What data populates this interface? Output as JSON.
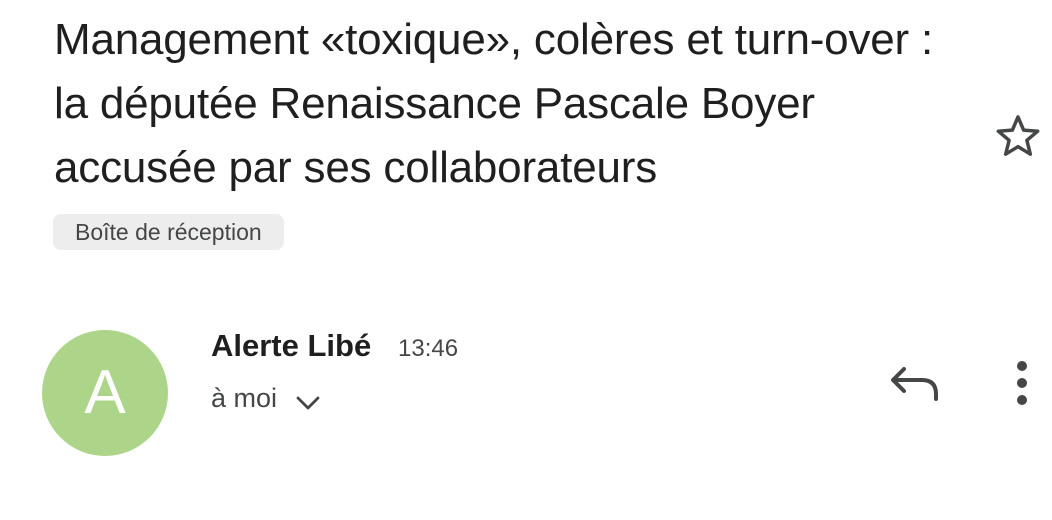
{
  "email": {
    "subject": "Management «toxique», colères et turn-over : la députée Renaissance Pascale Boyer accusée par ses collaborateurs",
    "label": "Boîte de réception",
    "sender": {
      "avatar_letter": "A",
      "avatar_color": "#acd58a",
      "name": "Alerte Libé",
      "time": "13:46"
    },
    "recipient": "à moi"
  },
  "icons": {
    "star": "star-outline-icon",
    "reply": "reply-icon",
    "more": "more-vertical-icon",
    "expand": "chevron-down-icon"
  }
}
